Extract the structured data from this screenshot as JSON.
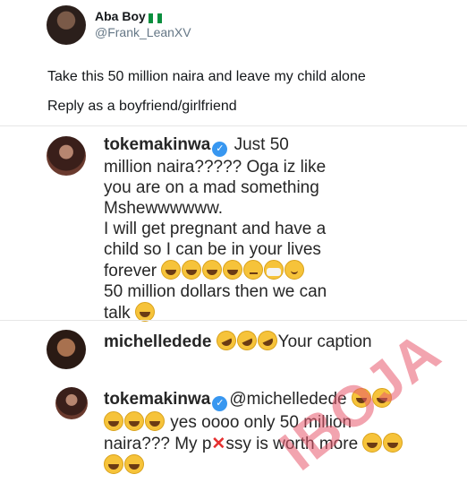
{
  "tweet": {
    "display_name": "Aba Boy",
    "handle": "@Frank_LeanXV",
    "line1": "Take this 50 million naira and leave my child alone",
    "line2": "Reply as a boyfriend/girlfriend"
  },
  "comments": [
    {
      "username": "tokemakinwa",
      "text_a": "Just 50",
      "text_b": "million naira????? Oga iz like",
      "text_c": "you are on a mad something",
      "text_d": "Mshewwwwww.",
      "text_e": "I will get pregnant and have a",
      "text_f": "child so I can be in your lives",
      "text_g": "forever",
      "text_h": "50 million dollars then we can",
      "text_i": "talk"
    },
    {
      "username": "michelledede",
      "text_a": "Your caption"
    },
    {
      "username": "tokemakinwa",
      "mention": "@michelledede",
      "text_a": "yes oooo only 50 million",
      "text_b": "naira??? My p",
      "text_c": "ssy is worth more"
    }
  ],
  "watermark": "IBOJA",
  "colors": {
    "verified": "#3897f0",
    "watermark": "#e85a6e"
  }
}
